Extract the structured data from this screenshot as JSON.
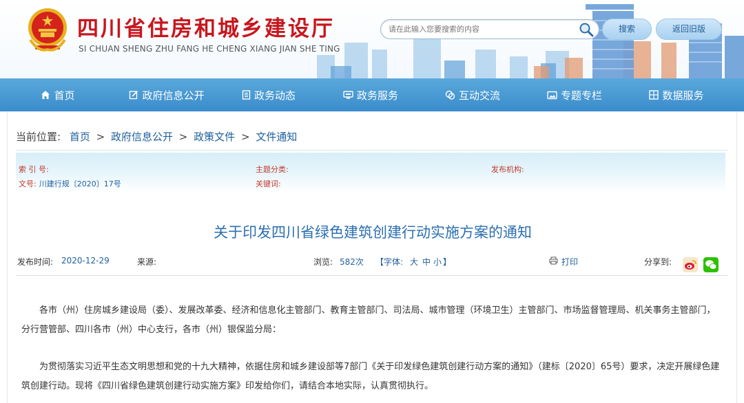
{
  "header": {
    "site_title": "四川省住房和城乡建设厅",
    "site_pinyin": "SI CHUAN SHENG ZHU FANG HE CHENG XIANG JIAN SHE TING",
    "search_placeholder": "请在此输入您要搜索的内容",
    "search_button": "搜索",
    "old_version_button": "返回旧版"
  },
  "nav": [
    {
      "label": "首页",
      "icon": "home-icon"
    },
    {
      "label": "政府信息公开",
      "icon": "edit-icon"
    },
    {
      "label": "政务动态",
      "icon": "document-icon"
    },
    {
      "label": "政务服务",
      "icon": "monitor-icon"
    },
    {
      "label": "互动交流",
      "icon": "chat-icon"
    },
    {
      "label": "专题专栏",
      "icon": "image-icon"
    },
    {
      "label": "数据服务",
      "icon": "grid-icon"
    }
  ],
  "breadcrumb": {
    "prefix": "当前位置:",
    "items": [
      "首页",
      "政府信息公开",
      "政策文件",
      "文件通知"
    ],
    "sep": ">"
  },
  "meta": {
    "index_key": "索 引 号:",
    "index_val": "",
    "topic_key": "主题分类:",
    "topic_val": "",
    "org_key": "发布机构:",
    "org_val": "",
    "docno_key": "文号:",
    "docno_val": "川建行规〔2020〕17号",
    "keywords_key": "关键词:",
    "keywords_val": ""
  },
  "article": {
    "title": "关于印发四川省绿色建筑创建行动实施方案的通知",
    "publish_label": "发布时间:",
    "publish_date": "2020-12-29",
    "source_label": "来源:",
    "views_label": "浏览:",
    "views_value": "582次",
    "font_label": "【字体:",
    "font_sizes": [
      "大",
      "中",
      "小"
    ],
    "font_close": "】",
    "print_label": "打印",
    "share_label": "分享到:",
    "paragraphs": [
      "各市（州）住房城乡建设局（委）、发展改革委、经济和信息化主管部门、教育主管部门、司法局、城市管理（环境卫生）主管部门、市场监督管理局、机关事务主管部门，分行营管部、四川各市（州）中心支行，各市（州）银保监分局：",
      "为贯彻落实习近平生态文明思想和党的十九大精神，依据住房和城乡建设部等7部门《关于印发绿色建筑创建行动方案的通知》（建标〔2020〕65号）要求，决定开展绿色建筑创建行动。现将《四川省绿色建筑创建行动实施方案》印发给你们，请结合本地实际，认真贯彻执行。"
    ]
  },
  "colors": {
    "brand_red": "#c8161d",
    "nav_blue": "#3a8ccb",
    "link_blue": "#1e5f9c",
    "title_blue": "#2c6fb1"
  }
}
